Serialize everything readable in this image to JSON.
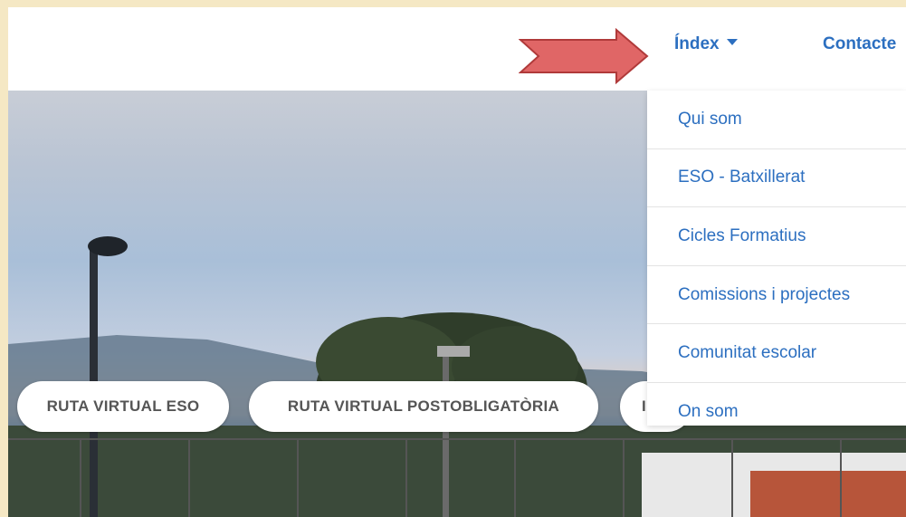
{
  "nav": {
    "index_label": "Índex",
    "contact_label": "Contacte"
  },
  "dropdown": {
    "items": [
      {
        "label": "Qui som"
      },
      {
        "label": "ESO - Batxillerat"
      },
      {
        "label": "Cicles Formatius"
      },
      {
        "label": "Comissions i projectes"
      },
      {
        "label": "Comunitat escolar"
      },
      {
        "label": "On som"
      }
    ]
  },
  "hero": {
    "buttons": [
      {
        "label": "RUTA VIRTUAL ESO"
      },
      {
        "label": "RUTA VIRTUAL POSTOBLIGATÒRIA"
      },
      {
        "label": "I"
      }
    ]
  },
  "colors": {
    "link": "#2c6fc0",
    "arrow_fill": "#e06666",
    "page_border": "#f5e8c4"
  },
  "icons": {
    "caret": "chevron-down-icon",
    "annotation": "arrow-right-icon"
  }
}
